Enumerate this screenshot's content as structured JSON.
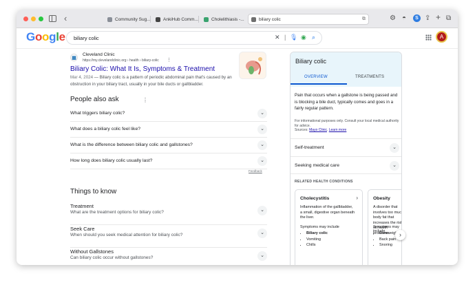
{
  "browser": {
    "tabs": [
      {
        "label": "Community Sug...",
        "favicon_color": "#8a8f98"
      },
      {
        "label": "AnkiHub Comm...",
        "favicon_color": "#444444"
      },
      {
        "label": "Cholelithiasis -...",
        "favicon_color": "#3aa36f"
      },
      {
        "label": "biliary colic",
        "favicon_color": "#6f6f6f"
      }
    ],
    "extension_badge": "S"
  },
  "google": {
    "logo": "Google",
    "query": "biliary colic",
    "avatar_letter": "A"
  },
  "result": {
    "site_name": "Cleveland Clinic",
    "site_url": "https://my.clevelandclinic.org › health › biliary-colic",
    "title": "Biliary Colic: What It Is, Symptoms & Treatment",
    "date": "Mar 4, 2024",
    "snippet": "Biliary colic is a pattern of periodic abdominal pain that's caused by an obstruction in your biliary tract, usually in your bile ducts or gallbladder."
  },
  "people_also_ask": {
    "heading": "People also ask",
    "questions": [
      "What triggers biliary colic?",
      "What does a biliary colic feel like?",
      "What is the difference between biliary colic and gallstones?",
      "How long does biliary colic usually last?"
    ],
    "feedback": "Feedback"
  },
  "things_to_know": {
    "heading": "Things to know",
    "items": [
      {
        "title": "Treatment",
        "subtitle": "What are the treatment options for biliary colic?"
      },
      {
        "title": "Seek Care",
        "subtitle": "When should you seek medical attention for biliary colic?"
      },
      {
        "title": "Without Gallstones",
        "subtitle": "Can biliary colic occur without gallstones?"
      }
    ]
  },
  "knowledge_panel": {
    "title": "Biliary colic",
    "tabs": [
      "OVERVIEW",
      "TREATMENTS"
    ],
    "definition": "Pain that occurs when a gallstone is being passed and is blocking a bile duct, typically comes and goes in a fairly regular pattern.",
    "note": "For informational purposes only. Consult your local medical authority for advice.",
    "sources_label": "Sources:",
    "source_link": "Mayo Clinic",
    "learn_more": "Learn more",
    "rows": [
      "Self-treatment",
      "Seeking medical care"
    ],
    "related_heading": "RELATED HEALTH CONDITIONS",
    "cards": [
      {
        "title": "Cholecystitis",
        "desc": "Inflammation of the gallbladder, a small, digestive organ beneath the liver.",
        "symptoms_label": "Symptoms may include",
        "symptoms": [
          "Biliary colic",
          "Vomiting",
          "Chills"
        ]
      },
      {
        "title": "Obesity",
        "desc": "A disorder that involves too much body fat that increases the risk of health problems.",
        "symptoms_label": "Symptoms may include",
        "symptoms": [
          "Overweight",
          "Back pain",
          "Snoring"
        ]
      }
    ]
  }
}
